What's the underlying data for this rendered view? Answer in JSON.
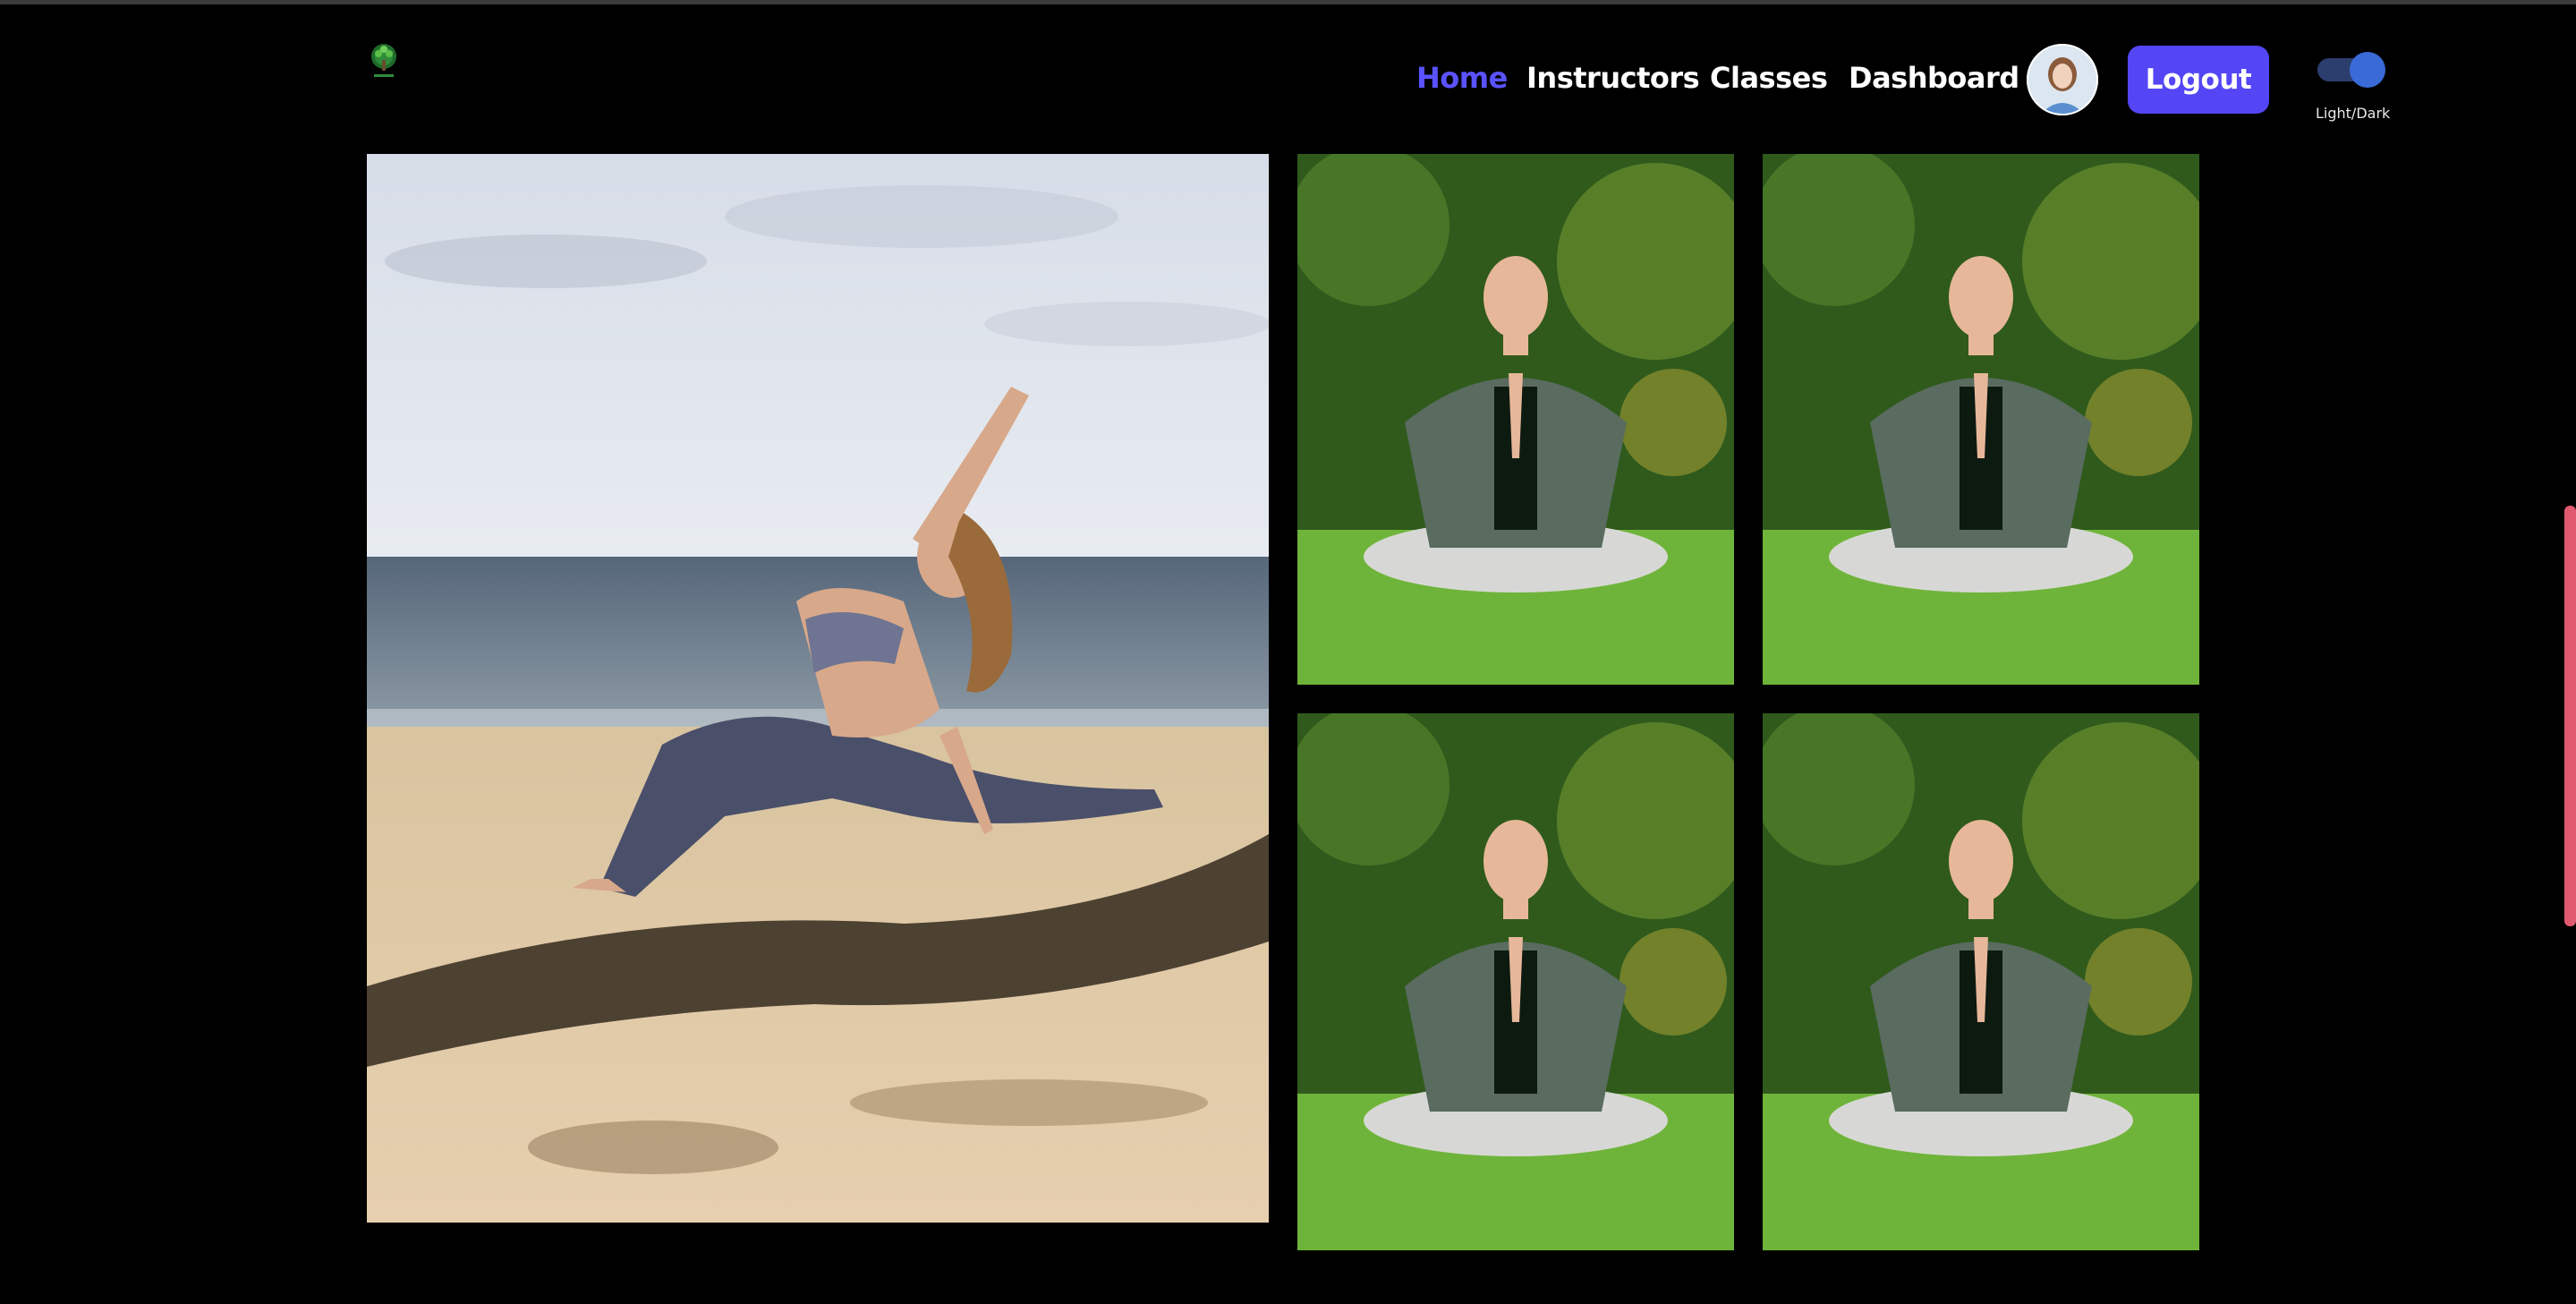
{
  "header": {
    "logo": "tree-logo",
    "nav": [
      {
        "label": "Home",
        "active": true
      },
      {
        "label": "Instructors",
        "active": false
      },
      {
        "label": "Classes",
        "active": false
      },
      {
        "label": "Dashboard",
        "active": false
      }
    ],
    "logout_label": "Logout",
    "theme_toggle": {
      "label": "Light/Dark",
      "on": true
    }
  },
  "gallery": {
    "main_image": "woman-beach-yoga-photo",
    "tiles": [
      "man-meditating-photo",
      "man-meditating-photo",
      "man-meditating-photo",
      "man-meditating-photo"
    ]
  },
  "colors": {
    "accent": "#5446f5",
    "active_link": "#5a52ff",
    "background": "#000000",
    "scrollbar": "#e0596e"
  }
}
